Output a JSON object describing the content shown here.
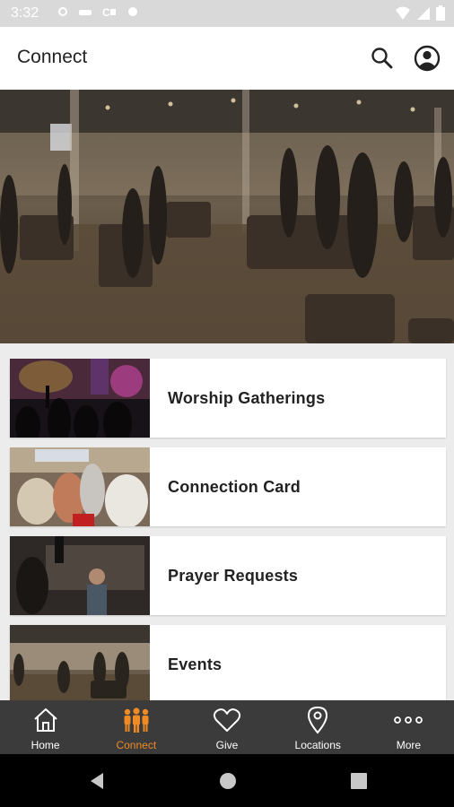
{
  "status_bar": {
    "time": "3:32"
  },
  "app_bar": {
    "title": "Connect"
  },
  "cards": [
    {
      "label": "Worship Gatherings"
    },
    {
      "label": "Connection Card"
    },
    {
      "label": "Prayer Requests"
    },
    {
      "label": "Events"
    }
  ],
  "bottom_nav": {
    "items": [
      {
        "label": "Home",
        "icon": "home-icon"
      },
      {
        "label": "Connect",
        "icon": "people-icon",
        "active": true
      },
      {
        "label": "Give",
        "icon": "heart-icon"
      },
      {
        "label": "Locations",
        "icon": "location-pin-icon"
      },
      {
        "label": "More",
        "icon": "more-dots-icon"
      }
    ]
  },
  "colors": {
    "accent": "#f08a24",
    "nav_bg": "#3b3b3b",
    "status_bg": "#d9d9d9"
  }
}
